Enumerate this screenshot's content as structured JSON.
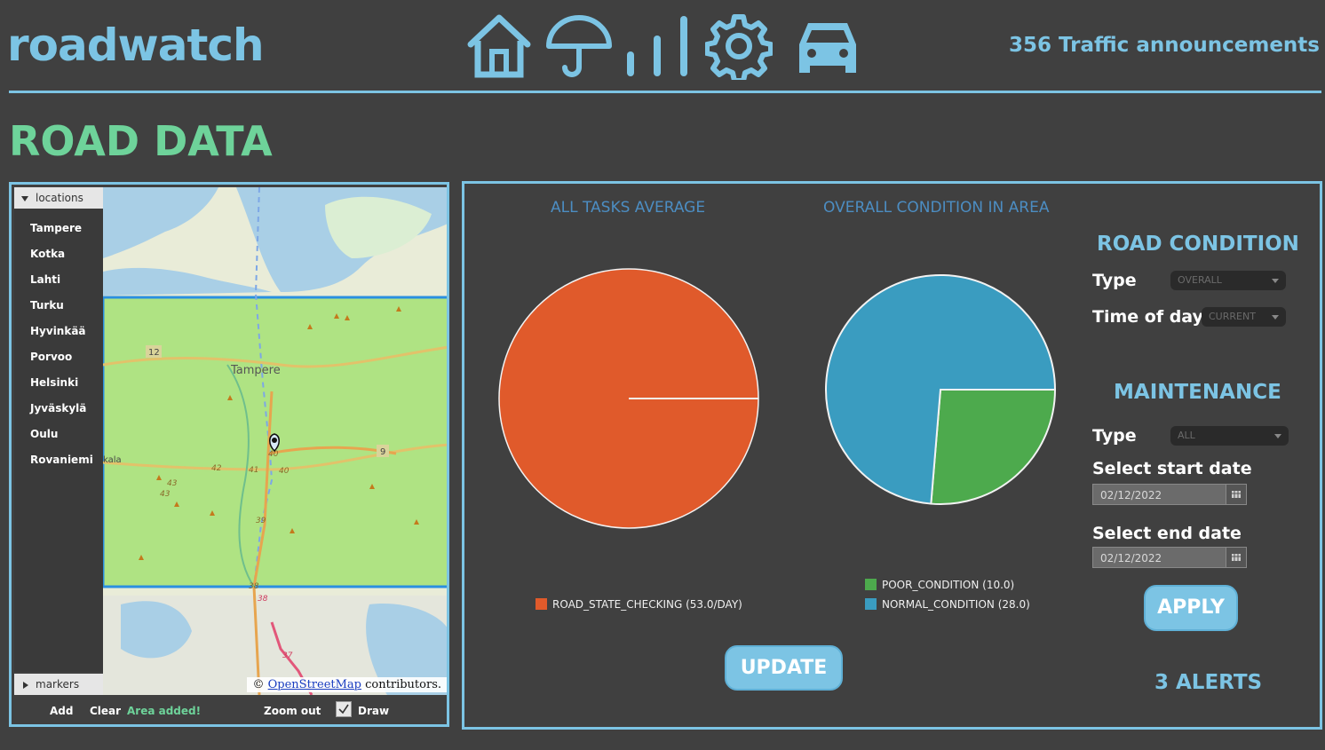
{
  "header": {
    "logo": "roadwatch",
    "announcements": "356 Traffic announcements",
    "nav_icons": [
      "home-icon",
      "umbrella-icon",
      "signal-bars-icon",
      "gear-icon",
      "car-icon"
    ]
  },
  "page": {
    "title": "ROAD DATA"
  },
  "locations": {
    "header": "locations",
    "items": [
      "Tampere",
      "Kotka",
      "Lahti",
      "Turku",
      "Hyvinkää",
      "Porvoo",
      "Helsinki",
      "Jyväskylä",
      "Oulu",
      "Rovaniemi"
    ],
    "markers_header": "markers"
  },
  "map": {
    "labels": {
      "city": "Tampere",
      "kala": "kala",
      "r12": "12",
      "r9": "9",
      "r42": "42",
      "r41": "41",
      "r40a": "40",
      "r40b": "40",
      "r43a": "43",
      "r43b": "43",
      "r39": "39",
      "r38": "38",
      "r38b": "38",
      "r37": "37"
    },
    "attribution_prefix": "©",
    "attribution_link": "OpenStreetMap",
    "attribution_suffix": "contributors."
  },
  "map_toolbar": {
    "add": "Add",
    "clear": "Clear",
    "status": "Area added!",
    "zoom_out": "Zoom out",
    "draw": "Draw",
    "draw_checked": true
  },
  "chart_data": [
    {
      "type": "pie",
      "title": "ALL TASKS AVERAGE",
      "slices": [
        {
          "label": "ROAD_STATE_CHECKING (53.0/DAY)",
          "value": 53.0,
          "color": "#e05a2b"
        }
      ]
    },
    {
      "type": "pie",
      "title": "OVERALL CONDITION IN AREA",
      "slices": [
        {
          "label": "POOR_CONDITION (10.0)",
          "value": 10.0,
          "color": "#4daa4d"
        },
        {
          "label": "NORMAL_CONDITION (28.0)",
          "value": 28.0,
          "color": "#3a9cc0"
        }
      ]
    }
  ],
  "buttons": {
    "update": "UPDATE",
    "apply": "APPLY"
  },
  "road_condition": {
    "heading": "ROAD CONDITION",
    "type_label": "Type",
    "type_value": "OVERALL",
    "time_label": "Time of day",
    "time_value": "CURRENT"
  },
  "maintenance": {
    "heading": "MAINTENANCE",
    "type_label": "Type",
    "type_value": "ALL",
    "start_label": "Select start date",
    "start_value": "02/12/2022",
    "end_label": "Select end date",
    "end_value": "02/12/2022"
  },
  "alerts": "3 ALERTS",
  "colors": {
    "accent": "#7cc4e4",
    "title_green": "#6ed39a",
    "chart_title": "#4c8dc2"
  }
}
